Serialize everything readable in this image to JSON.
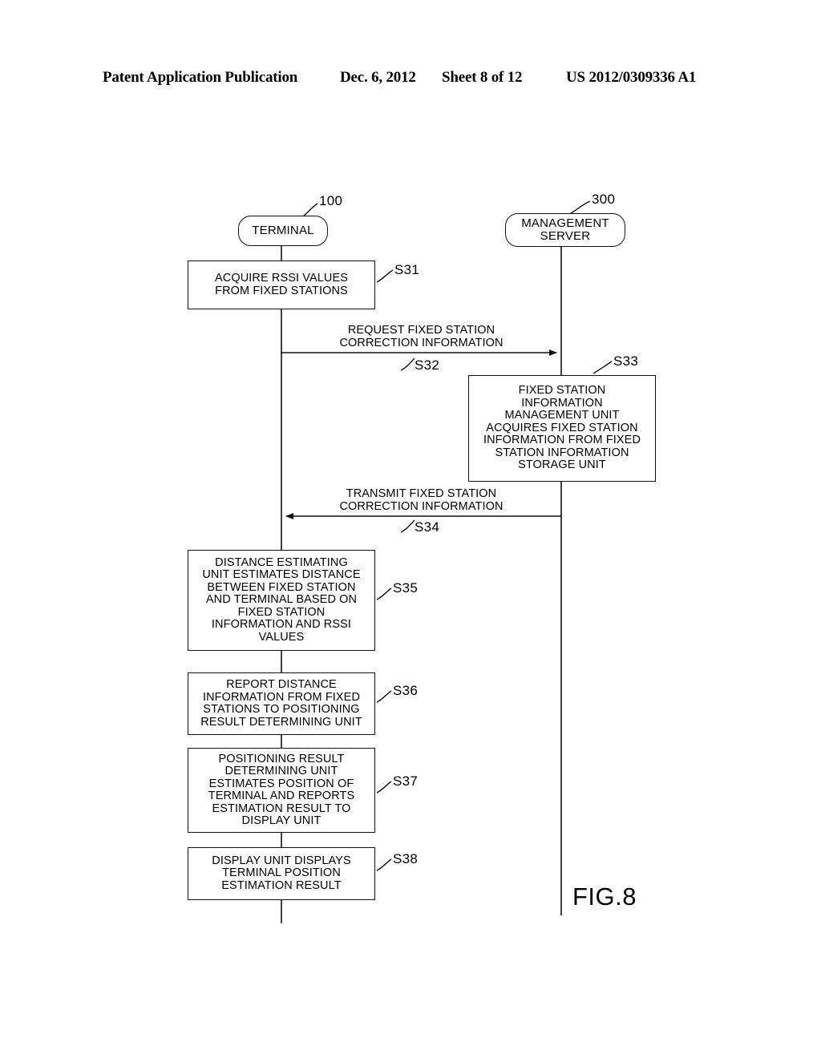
{
  "header": {
    "publication": "Patent Application Publication",
    "date": "Dec. 6, 2012",
    "sheet": "Sheet 8 of 12",
    "number": "US 2012/0309336 A1"
  },
  "figure": {
    "caption": "FIG.8",
    "lanes": [
      {
        "id": "terminal",
        "label": "TERMINAL",
        "ref": "100"
      },
      {
        "id": "management-server",
        "label": "MANAGEMENT\nSERVER",
        "ref": "300"
      }
    ],
    "steps": [
      {
        "id": "S31",
        "tag": "S31",
        "lane": "terminal",
        "kind": "process",
        "text": "ACQUIRE RSSI VALUES\nFROM FIXED STATIONS"
      },
      {
        "id": "S32",
        "tag": "S32",
        "kind": "message",
        "from": "terminal",
        "to": "management-server",
        "direction": "right",
        "text": "REQUEST FIXED STATION\nCORRECTION INFORMATION"
      },
      {
        "id": "S33",
        "tag": "S33",
        "lane": "management-server",
        "kind": "process",
        "text": "FIXED STATION\nINFORMATION\nMANAGEMENT UNIT\nACQUIRES FIXED STATION\nINFORMATION FROM FIXED\nSTATION INFORMATION\nSTORAGE UNIT"
      },
      {
        "id": "S34",
        "tag": "S34",
        "kind": "message",
        "from": "management-server",
        "to": "terminal",
        "direction": "left",
        "text": "TRANSMIT FIXED STATION\nCORRECTION INFORMATION"
      },
      {
        "id": "S35",
        "tag": "S35",
        "lane": "terminal",
        "kind": "process",
        "text": "DISTANCE ESTIMATING\nUNIT ESTIMATES DISTANCE\nBETWEEN FIXED STATION\nAND TERMINAL BASED ON\nFIXED STATION\nINFORMATION AND RSSI\nVALUES"
      },
      {
        "id": "S36",
        "tag": "S36",
        "lane": "terminal",
        "kind": "process",
        "text": "REPORT DISTANCE\nINFORMATION FROM FIXED\nSTATIONS TO POSITIONING\nRESULT DETERMINING UNIT"
      },
      {
        "id": "S37",
        "tag": "S37",
        "lane": "terminal",
        "kind": "process",
        "text": "POSITIONING RESULT\nDETERMINING UNIT\nESTIMATES POSITION OF\nTERMINAL AND REPORTS\nESTIMATION RESULT TO\nDISPLAY UNIT"
      },
      {
        "id": "S38",
        "tag": "S38",
        "lane": "terminal",
        "kind": "process",
        "text": "DISPLAY UNIT DISPLAYS\nTERMINAL POSITION\nESTIMATION RESULT"
      }
    ]
  },
  "colors": {
    "ink": "#000000",
    "paper": "#ffffff"
  }
}
